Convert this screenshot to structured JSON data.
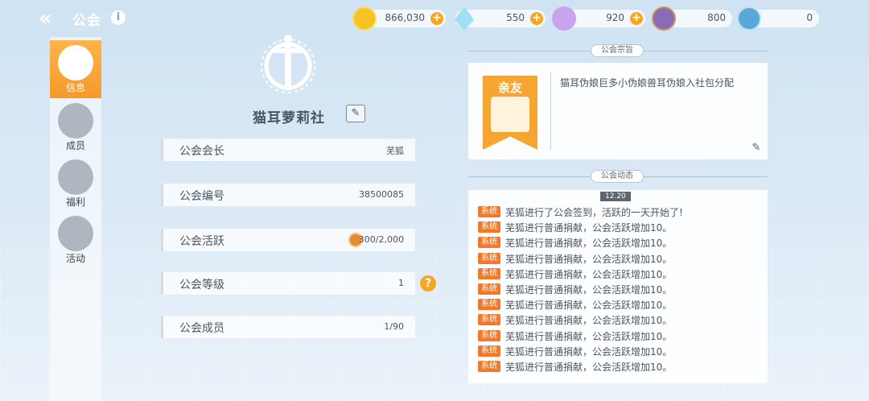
{
  "header": {
    "title": "公会"
  },
  "currencies": [
    {
      "icon": "gold-coin-icon",
      "value": "866,030",
      "color": "#f5c323"
    },
    {
      "icon": "crystal-icon",
      "value": "550",
      "color": "#7fd3f2"
    },
    {
      "icon": "rocket-icon",
      "value": "920",
      "color": "#b98ce6"
    },
    {
      "icon": "medal-icon",
      "value": "800",
      "color": "#8a6bb8"
    },
    {
      "icon": "compass-icon",
      "value": "0",
      "color": "#5aa8d8"
    }
  ],
  "sidebar": {
    "items": [
      {
        "label": "信息",
        "icon": "shield-icon",
        "active": true
      },
      {
        "label": "成员",
        "icon": "members-icon",
        "active": false
      },
      {
        "label": "福利",
        "icon": "gift-icon",
        "active": false
      },
      {
        "label": "活动",
        "icon": "balloon-icon",
        "active": false
      }
    ]
  },
  "guild": {
    "name": "猫耳萝莉社",
    "rows": [
      {
        "label": "公会会长",
        "value": "芜狐"
      },
      {
        "label": "公会编号",
        "value": "38500085"
      },
      {
        "label": "公会活跃",
        "value": "300/2,000"
      },
      {
        "label": "公会等级",
        "value": "1"
      },
      {
        "label": "公会成员",
        "value": "1/90"
      }
    ]
  },
  "motto": {
    "header": "公会宗旨",
    "badge": "亲友",
    "text": "猫耳伪娘巨多小伪娘兽耳伪娘入社包分配"
  },
  "log": {
    "header": "公会动态",
    "date": "12.20",
    "badge": "系统",
    "entries": [
      "芜狐进行了公会签到，活跃的一天开始了!",
      "芜狐进行普通捐献，公会活跃增加10。",
      "芜狐进行普通捐献，公会活跃增加10。",
      "芜狐进行普通捐献，公会活跃增加10。",
      "芜狐进行普通捐献，公会活跃增加10。",
      "芜狐进行普通捐献，公会活跃增加10。",
      "芜狐进行普通捐献，公会活跃增加10。",
      "芜狐进行普通捐献，公会活跃增加10。",
      "芜狐进行普通捐献，公会活跃增加10。",
      "芜狐进行普通捐献，公会活跃增加10。",
      "芜狐进行普通捐献，公会活跃增加10。"
    ]
  }
}
